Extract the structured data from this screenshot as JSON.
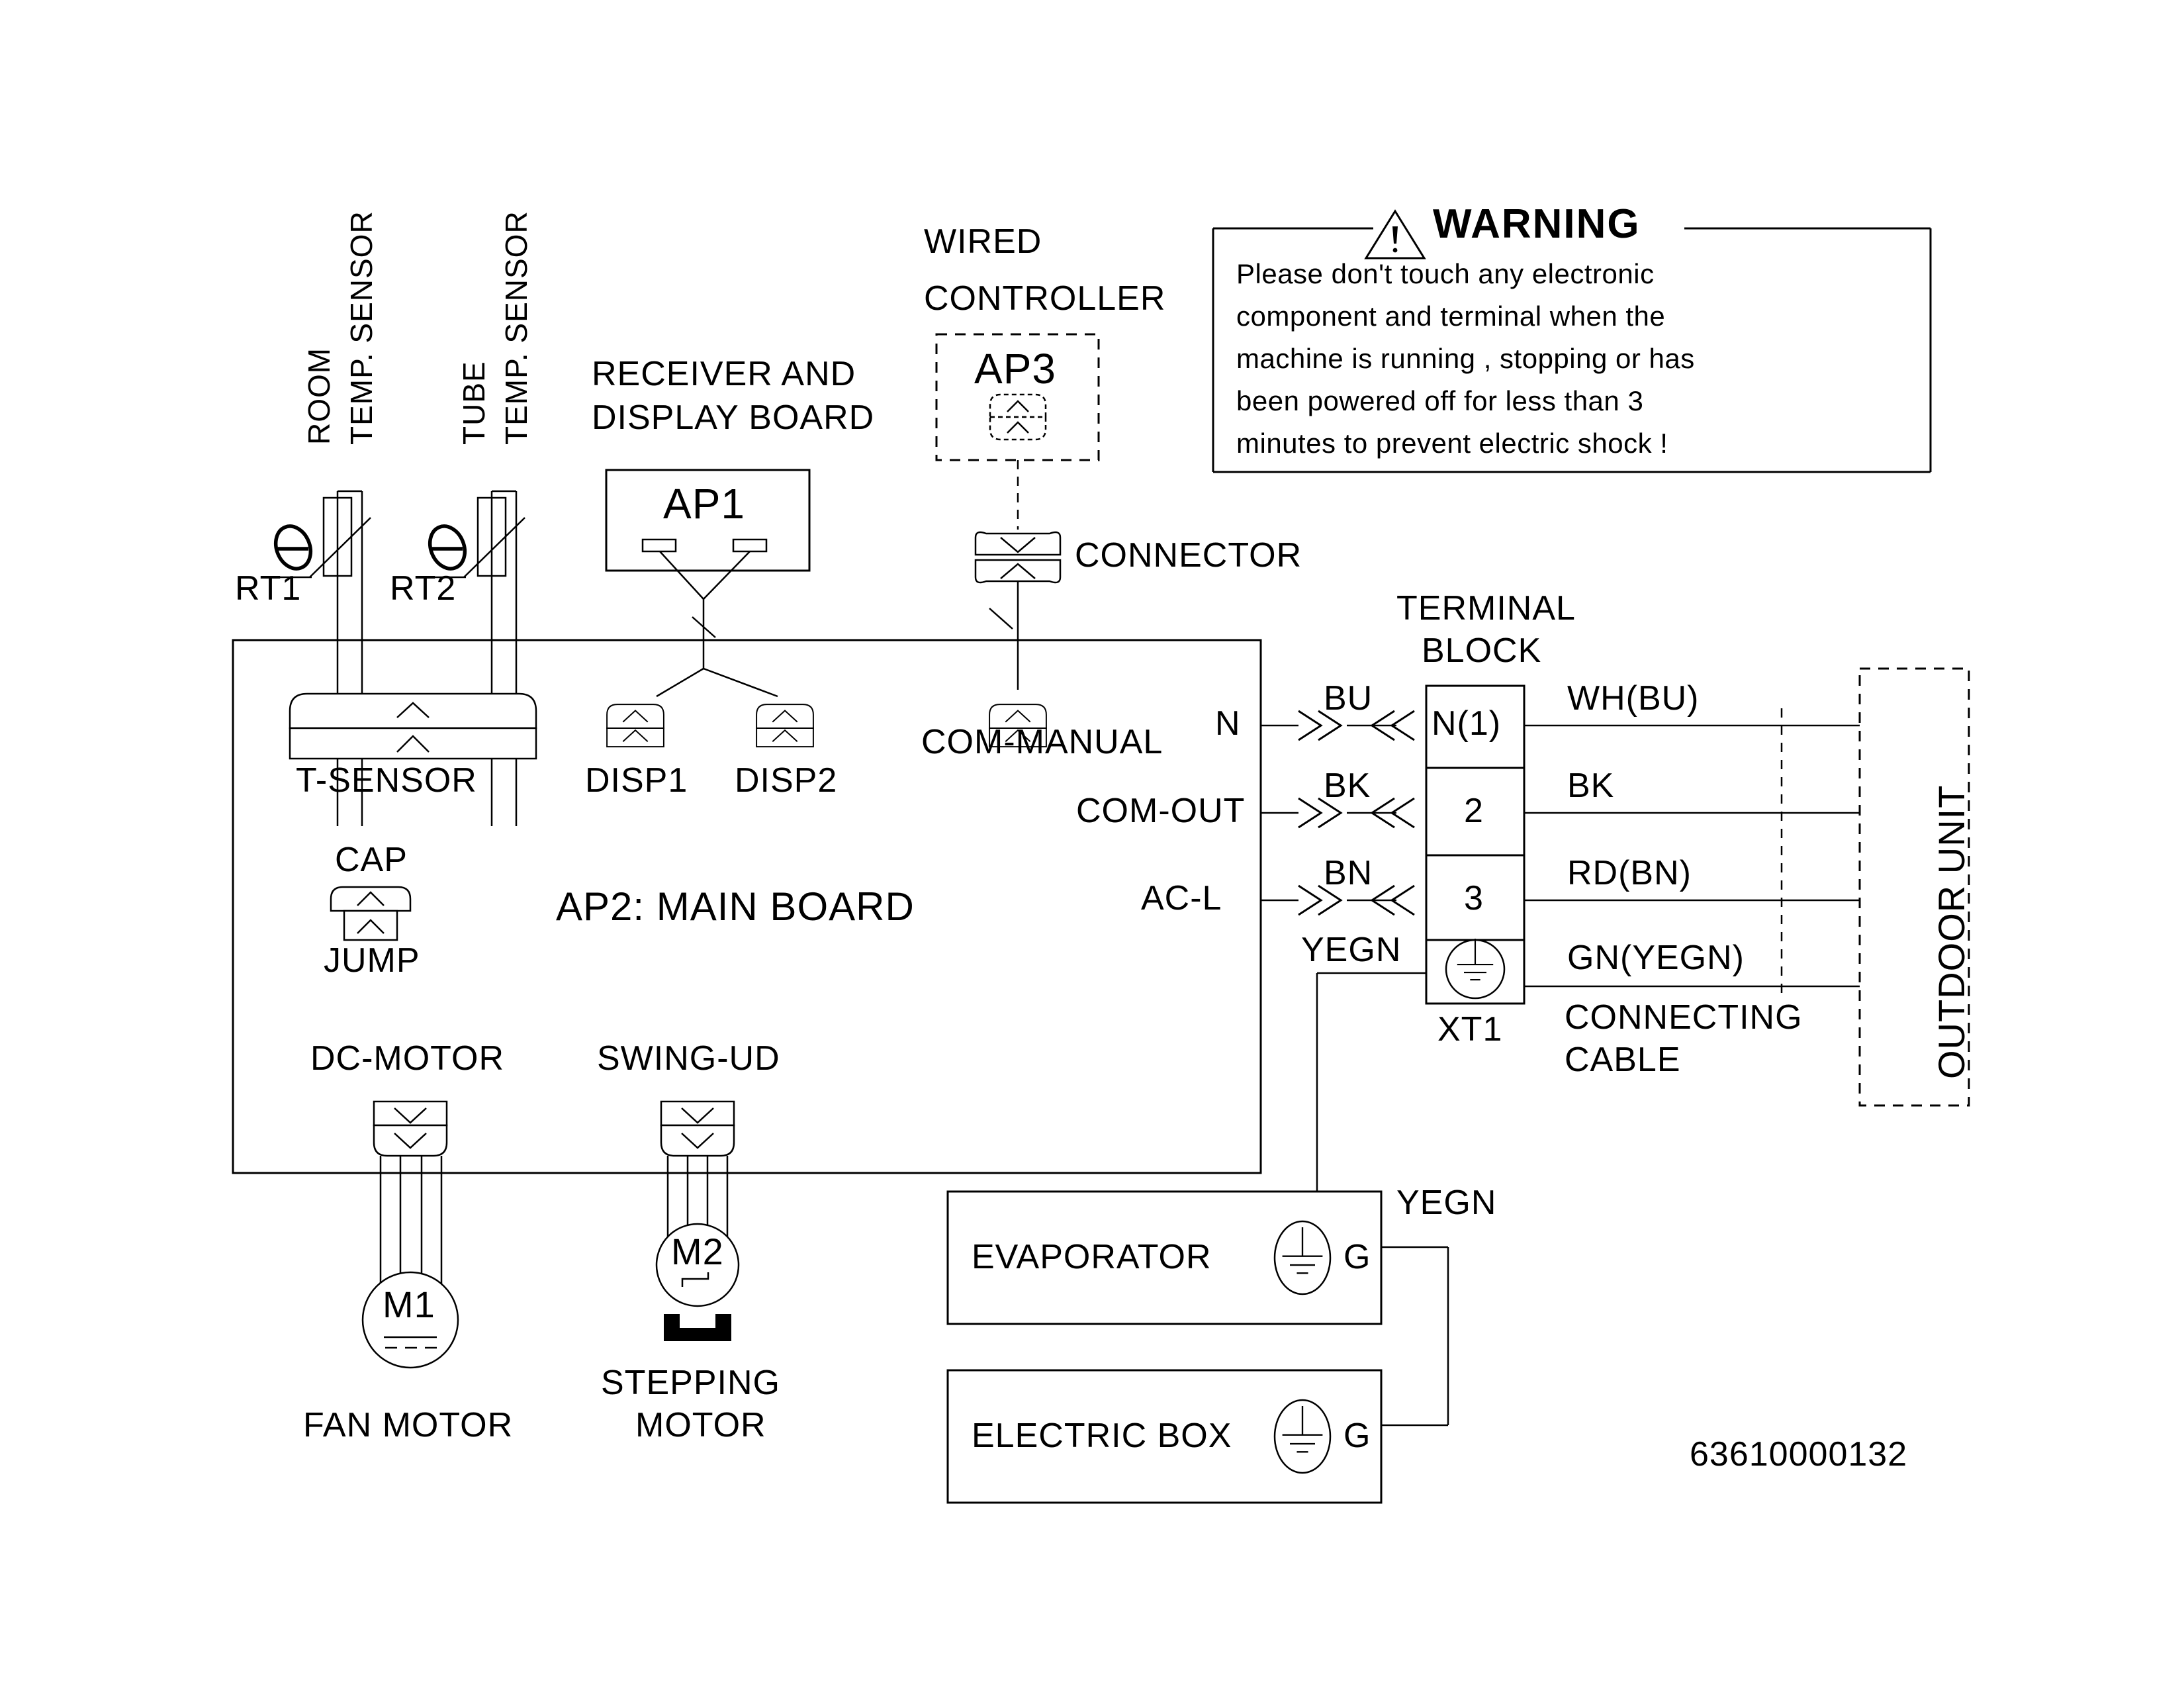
{
  "diagram": {
    "part_number": "63610000132"
  },
  "warning": {
    "title": "WARNING",
    "icon": "warning-triangle-icon",
    "lines": [
      "Please don't touch any electronic",
      "component and terminal when the",
      "machine is running , stopping or has",
      "been powered off for less than 3",
      "minutes to prevent electric shock !"
    ]
  },
  "sensors": {
    "room_label_line1": "ROOM",
    "room_label_line2": "TEMP. SENSOR",
    "tube_label_line1": "TUBE",
    "tube_label_line2": "TEMP. SENSOR",
    "rt1": "RT1",
    "rt2": "RT2",
    "t_sensor": "T-SENSOR"
  },
  "receiver_board": {
    "caption_line1": "RECEIVER AND",
    "caption_line2": "DISPLAY BOARD",
    "id": "AP1",
    "disp1": "DISP1",
    "disp2": "DISP2"
  },
  "wired_controller": {
    "caption_line1": "WIRED",
    "caption_line2": "CONTROLLER",
    "id": "AP3",
    "connector_label": "CONNECTOR",
    "com_manual": "COM-MANUAL"
  },
  "main_board": {
    "title": "AP2: MAIN BOARD",
    "cap": "CAP",
    "jump": "JUMP",
    "dc_motor": "DC-MOTOR",
    "swing_ud": "SWING-UD",
    "terminals": [
      "N",
      "COM-OUT",
      "AC-L"
    ]
  },
  "motors": {
    "fan_symbol": "M1",
    "fan_label": "FAN MOTOR",
    "stepping_symbol": "M2",
    "stepping_label_line1": "STEPPING",
    "stepping_label_line2": "MOTOR"
  },
  "terminal_block": {
    "caption_line1": "TERMINAL",
    "caption_line2": "BLOCK",
    "id": "XT1",
    "rows": [
      {
        "left_wire": "BU",
        "terminal": "N(1)",
        "right_wire": "WH(BU)"
      },
      {
        "left_wire": "BK",
        "terminal": "2",
        "right_wire": "BK"
      },
      {
        "left_wire": "BN",
        "terminal": "3",
        "right_wire": "RD(BN)"
      },
      {
        "left_wire": "YEGN",
        "terminal": "ground-symbol",
        "right_wire": "GN(YEGN)"
      }
    ],
    "cable_line1": "CONNECTING",
    "cable_line2": "CABLE"
  },
  "outdoor_unit": {
    "label": "OUTDOOR UNIT"
  },
  "ground_boxes": {
    "evaporator": "EVAPORATOR",
    "evaporator_terminal": "G",
    "electric_box": "ELECTRIC BOX",
    "electric_box_terminal": "G",
    "yegn_label": "YEGN"
  }
}
